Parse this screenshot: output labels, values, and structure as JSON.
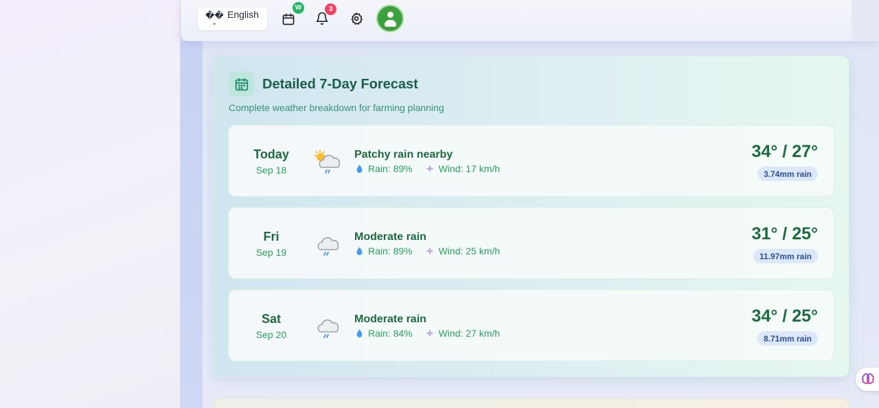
{
  "header": {
    "language_glyph": "��",
    "language_label": "English",
    "language_chevron": "⌄",
    "calendar_badge": "W",
    "notification_count": "3"
  },
  "forecast": {
    "title": "Detailed 7-Day Forecast",
    "subtitle": "Complete weather breakdown for farming planning",
    "days": [
      {
        "day": "Today",
        "date": "Sep 18",
        "icon": "partly-cloudy-rain-icon",
        "condition": "Patchy rain nearby",
        "rain_chance": "Rain: 89%",
        "wind": "Wind: 17 km/h",
        "temps": "34° / 27°",
        "rain_amount": "3.74mm rain"
      },
      {
        "day": "Fri",
        "date": "Sep 19",
        "icon": "cloud-rain-icon",
        "condition": "Moderate rain",
        "rain_chance": "Rain: 89%",
        "wind": "Wind: 25 km/h",
        "temps": "31° / 25°",
        "rain_amount": "11.97mm rain"
      },
      {
        "day": "Sat",
        "date": "Sep 20",
        "icon": "cloud-rain-icon",
        "condition": "Moderate rain",
        "rain_chance": "Rain: 84%",
        "wind": "Wind: 27 km/h",
        "temps": "34° / 25°",
        "rain_amount": "8.71mm rain"
      }
    ]
  },
  "colors": {
    "accent_green": "#1d6a3f",
    "secondary_green": "#2aa05a",
    "badge_blue_bg": "#dce8f9",
    "badge_blue_text": "#2c4f94",
    "notification_red": "#ef4463",
    "avatar_green": "#3ca03c"
  }
}
